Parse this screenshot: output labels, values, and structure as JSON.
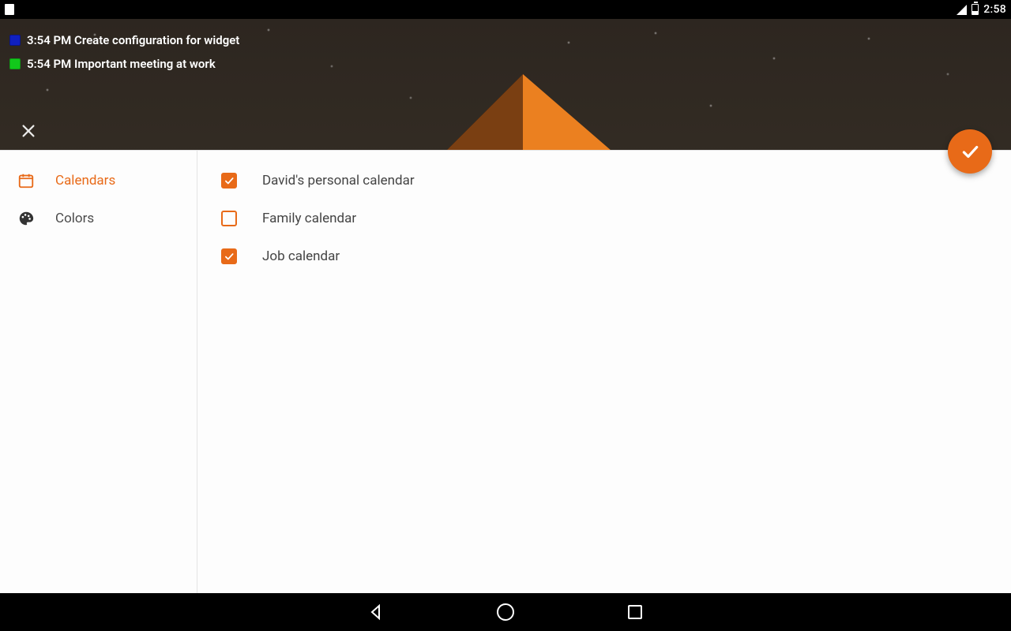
{
  "statusbar": {
    "time": "2:58"
  },
  "widget": {
    "events": [
      {
        "color": "blue",
        "time": "3:54 PM",
        "title": "Create configuration for widget"
      },
      {
        "color": "green",
        "time": "5:54 PM",
        "title": "Important meeting at work"
      }
    ]
  },
  "sidebar": {
    "items": [
      {
        "key": "calendars",
        "label": "Calendars",
        "icon": "calendar"
      },
      {
        "key": "colors",
        "label": "Colors",
        "icon": "palette"
      }
    ],
    "active": "calendars"
  },
  "calendars": {
    "items": [
      {
        "label": "David's personal calendar",
        "checked": true
      },
      {
        "label": "Family calendar",
        "checked": false
      },
      {
        "label": "Job calendar",
        "checked": true
      }
    ]
  },
  "colors": {
    "accent": "#e86a18"
  }
}
